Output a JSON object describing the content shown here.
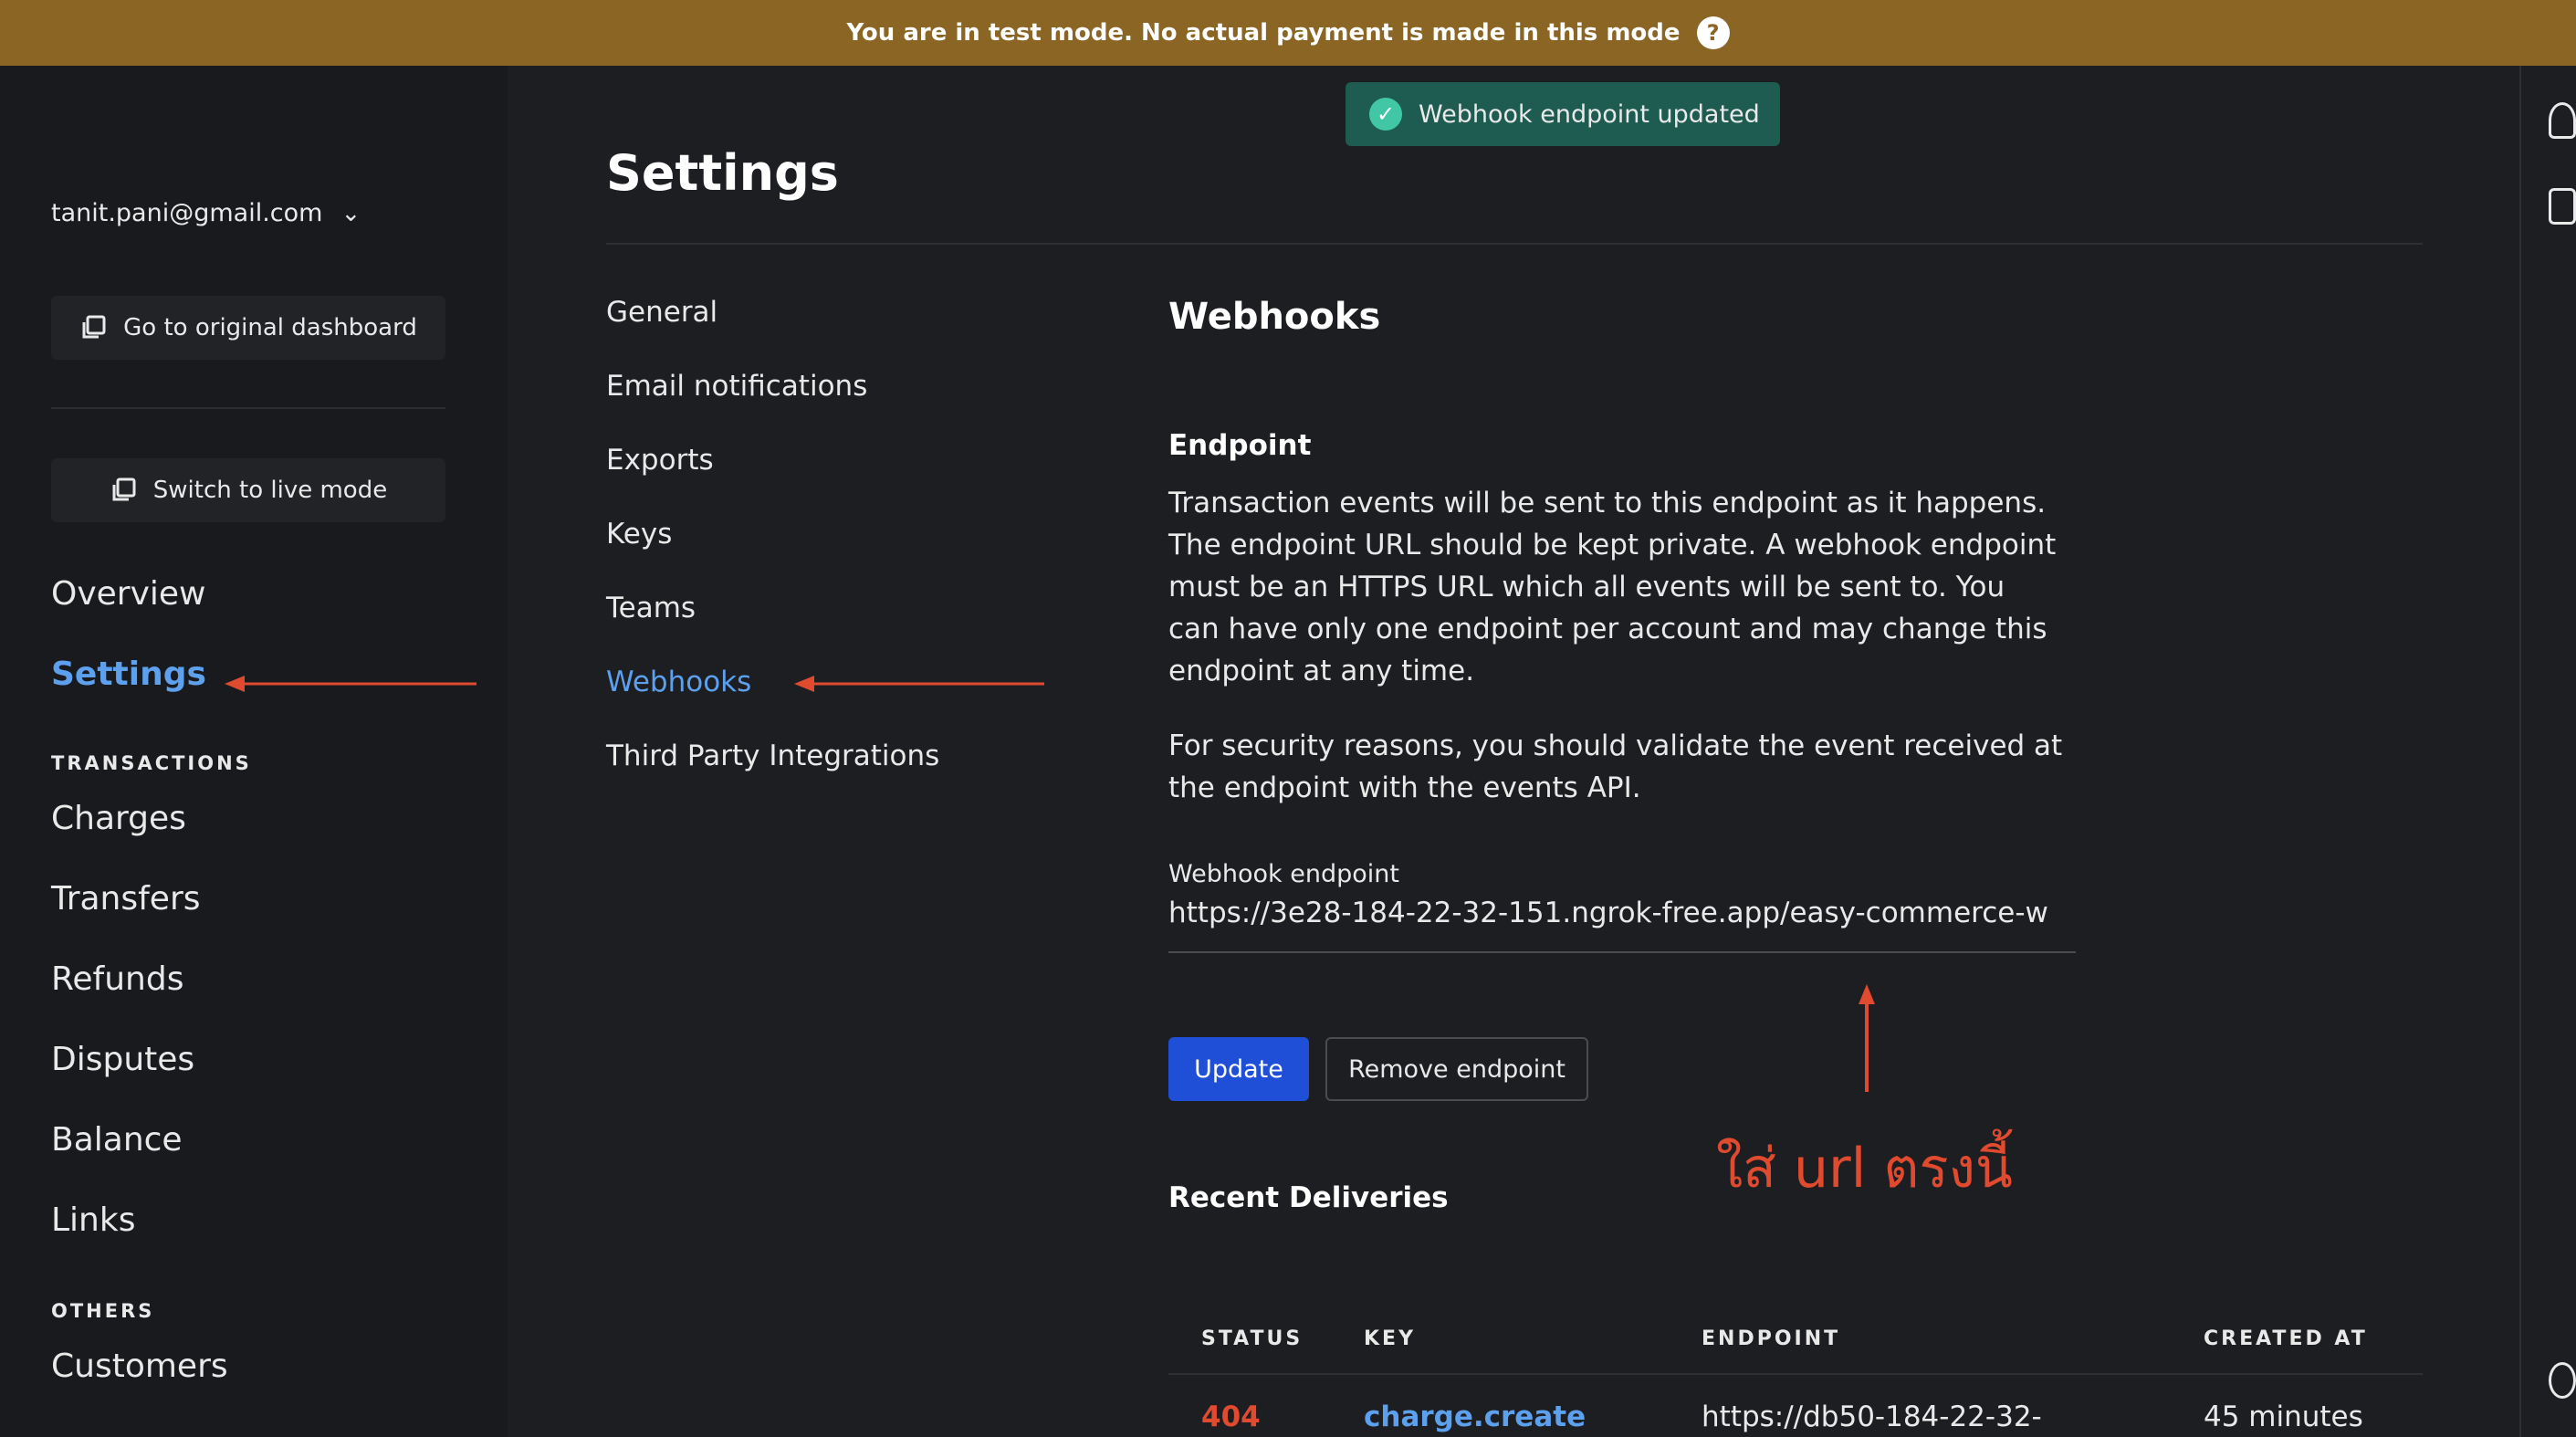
{
  "banner": {
    "text": "You are in test mode. No actual payment is made in this mode",
    "help": "?"
  },
  "toast": {
    "text": "Webhook endpoint updated"
  },
  "sidebar": {
    "account": "tanit.pani@gmail.com",
    "original_dashboard": "Go to original dashboard",
    "switch_mode": "Switch to live mode",
    "overview": "Overview",
    "settings": "Settings",
    "transactions_label": "TRANSACTIONS",
    "charges": "Charges",
    "transfers": "Transfers",
    "refunds": "Refunds",
    "disputes": "Disputes",
    "balance": "Balance",
    "links": "Links",
    "others_label": "OTHERS",
    "customers": "Customers"
  },
  "page": {
    "title": "Settings"
  },
  "subnav": {
    "general": "General",
    "email": "Email notifications",
    "exports": "Exports",
    "keys": "Keys",
    "teams": "Teams",
    "webhooks": "Webhooks",
    "third_party": "Third Party Integrations"
  },
  "webhooks": {
    "title": "Webhooks",
    "endpoint_heading": "Endpoint",
    "desc1": "Transaction events will be sent to this endpoint as it happens. The endpoint URL should be kept private. A webhook endpoint must be an HTTPS URL which all events will be sent to. You can have only one endpoint per account and may change this endpoint at any time.",
    "desc2": "For security reasons, you should validate the event received at the endpoint with the events API.",
    "field_label": "Webhook endpoint",
    "field_value": "https://3e28-184-22-32-151.ngrok-free.app/easy-commerce-w",
    "update": "Update",
    "remove": "Remove endpoint",
    "annotation": "ใส่ url ตรงนี้",
    "recent": "Recent Deliveries"
  },
  "deliveries": {
    "headers": [
      "STATUS",
      "KEY",
      "ENDPOINT",
      "CREATED AT"
    ],
    "row": {
      "status": "404",
      "key": "charge.create",
      "endpoint": "https://db50-184-22-32-",
      "created": "45 minutes"
    }
  },
  "colors": {
    "banner": "#8a6524",
    "accent": "#5ca0ee",
    "primary": "#1f4fd6",
    "annotation": "#e04a2f",
    "toast": "#1e5b50"
  }
}
